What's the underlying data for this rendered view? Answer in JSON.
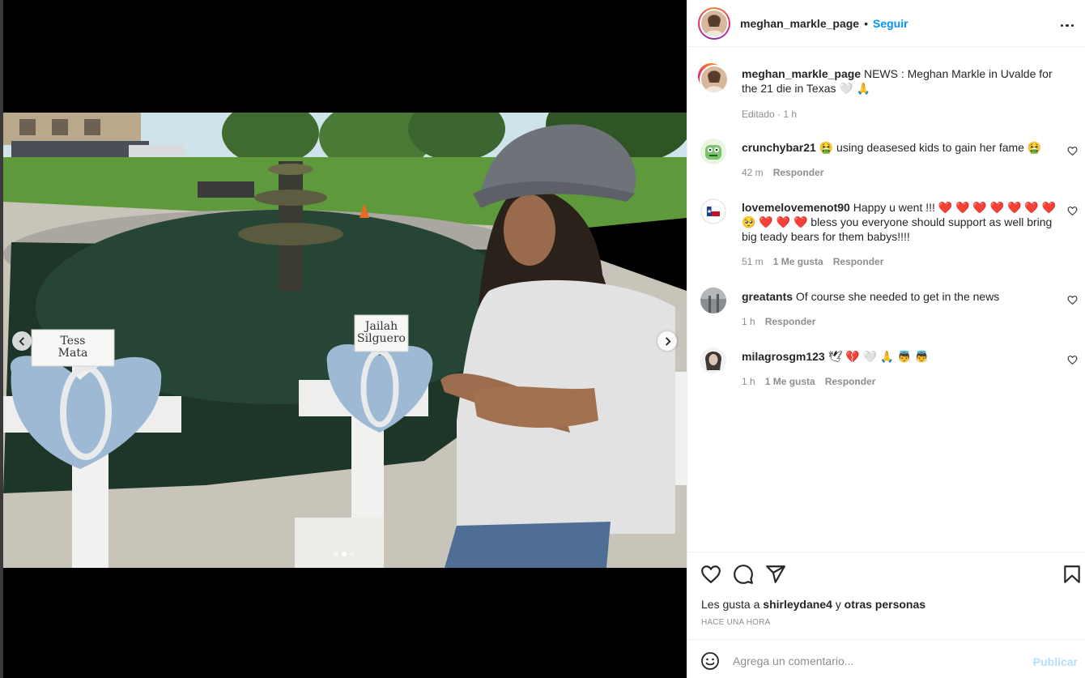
{
  "post": {
    "username": "meghan_markle_page",
    "separator": "•",
    "follow_label": "Seguir",
    "caption_text": "NEWS : Meghan Markle in Uvalde for the 21 die in Texas 🤍 🙏",
    "edited_label": "Editado · 1 h"
  },
  "photo": {
    "cross_left_text": "Tess\nMata",
    "cross_right_text": "Jailah\nSilguero"
  },
  "carousel": {
    "current": 2,
    "total": 3
  },
  "comments": [
    {
      "username": "crunchybar21",
      "text": "🤮 using deasesed kids to gain her fame 🤮",
      "time": "42 m",
      "likes": "",
      "reply": "Responder"
    },
    {
      "username": "lovemelovemenot90",
      "text": "Happy u went !!! ❤️ ❤️ ❤️ ❤️ ❤️ ❤️ ❤️ 🥺 ❤️ ❤️ ❤️ bless you everyone should support as well bring big teady bears for them babys!!!!",
      "time": "51 m",
      "likes": "1 Me gusta",
      "reply": "Responder"
    },
    {
      "username": "greatants",
      "text": "Of course she needed to get in the news",
      "time": "1 h",
      "likes": "",
      "reply": "Responder"
    },
    {
      "username": "milagrosgm123",
      "text": "🕊 💔 🤍 🙏 👼 👼",
      "time": "1 h",
      "likes": "1 Me gusta",
      "reply": "Responder"
    }
  ],
  "likes": {
    "prefix": "Les gusta a",
    "user": "shirleydane4",
    "joiner": "y",
    "others": "otras personas"
  },
  "timestamp": "HACE UNA HORA",
  "comment_box": {
    "placeholder": "Agrega un comentario...",
    "publish_label": "Publicar"
  },
  "colors": {
    "follow": "#0095f6",
    "publish_disabled": "#b2dffc",
    "meta_gray": "#8e8e8e"
  }
}
